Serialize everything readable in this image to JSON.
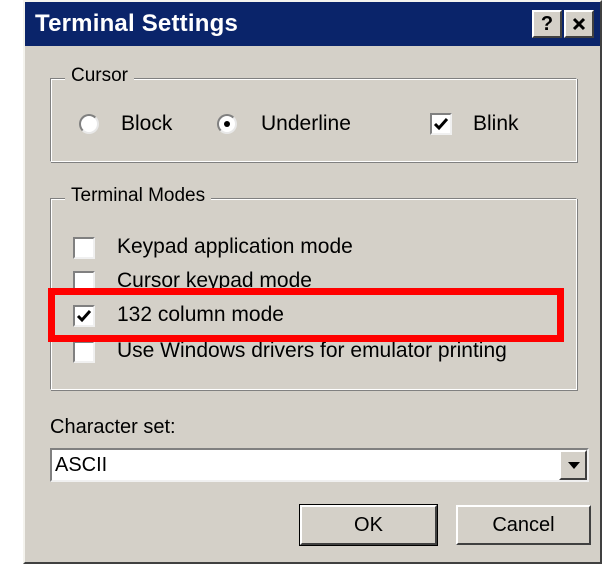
{
  "window": {
    "title": "Terminal Settings",
    "help_button": "?",
    "close_button": "✕"
  },
  "cursor_group": {
    "legend": "Cursor",
    "options": [
      {
        "label": "Block",
        "selected": false
      },
      {
        "label": "Underline",
        "selected": true
      }
    ],
    "blink": {
      "label": "Blink",
      "checked": true
    }
  },
  "modes_group": {
    "legend": "Terminal Modes",
    "items": [
      {
        "label": "Keypad application mode",
        "checked": false
      },
      {
        "label": "Cursor keypad mode",
        "checked": false
      },
      {
        "label": "132 column mode",
        "checked": true
      },
      {
        "label": "Use Windows drivers for emulator printing",
        "checked": false
      }
    ]
  },
  "charset": {
    "label": "Character set:",
    "value": "ASCII"
  },
  "buttons": {
    "ok": "OK",
    "cancel": "Cancel"
  },
  "colors": {
    "titlebar": "#0a246a",
    "dialog_face": "#d4d0c8",
    "highlight": "#ff0000"
  }
}
